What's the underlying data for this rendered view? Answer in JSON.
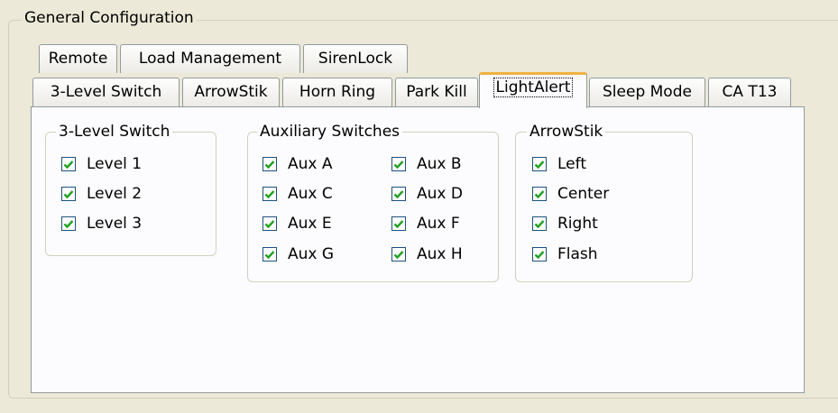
{
  "general_title": "General Configuration",
  "tabs_row1": [
    "Remote",
    "Load Management",
    "SirenLock"
  ],
  "tabs_row2": [
    "3-Level Switch",
    "ArrowStik",
    "Horn Ring",
    "Park Kill",
    "LightAlert",
    "Sleep Mode",
    "CA T13"
  ],
  "active_tab": "LightAlert",
  "groups": {
    "level_switch": {
      "title": "3-Level Switch",
      "items": [
        {
          "label": "Level 1",
          "checked": true
        },
        {
          "label": "Level 2",
          "checked": true
        },
        {
          "label": "Level 3",
          "checked": true
        }
      ]
    },
    "aux_switches": {
      "title": "Auxiliary Switches",
      "items": [
        {
          "label": "Aux A",
          "checked": true
        },
        {
          "label": "Aux B",
          "checked": true
        },
        {
          "label": "Aux C",
          "checked": true
        },
        {
          "label": "Aux D",
          "checked": true
        },
        {
          "label": "Aux E",
          "checked": true
        },
        {
          "label": "Aux F",
          "checked": true
        },
        {
          "label": "Aux G",
          "checked": true
        },
        {
          "label": "Aux H",
          "checked": true
        }
      ]
    },
    "arrowstik": {
      "title": "ArrowStik",
      "items": [
        {
          "label": "Left",
          "checked": true
        },
        {
          "label": "Center",
          "checked": true
        },
        {
          "label": "Right",
          "checked": true
        },
        {
          "label": "Flash",
          "checked": true
        }
      ]
    }
  },
  "colors": {
    "checkmark": "#21a121",
    "checkbox_border": "#1c5180",
    "active_tab_accent": "#f0b040",
    "background": "#ece9d8"
  }
}
